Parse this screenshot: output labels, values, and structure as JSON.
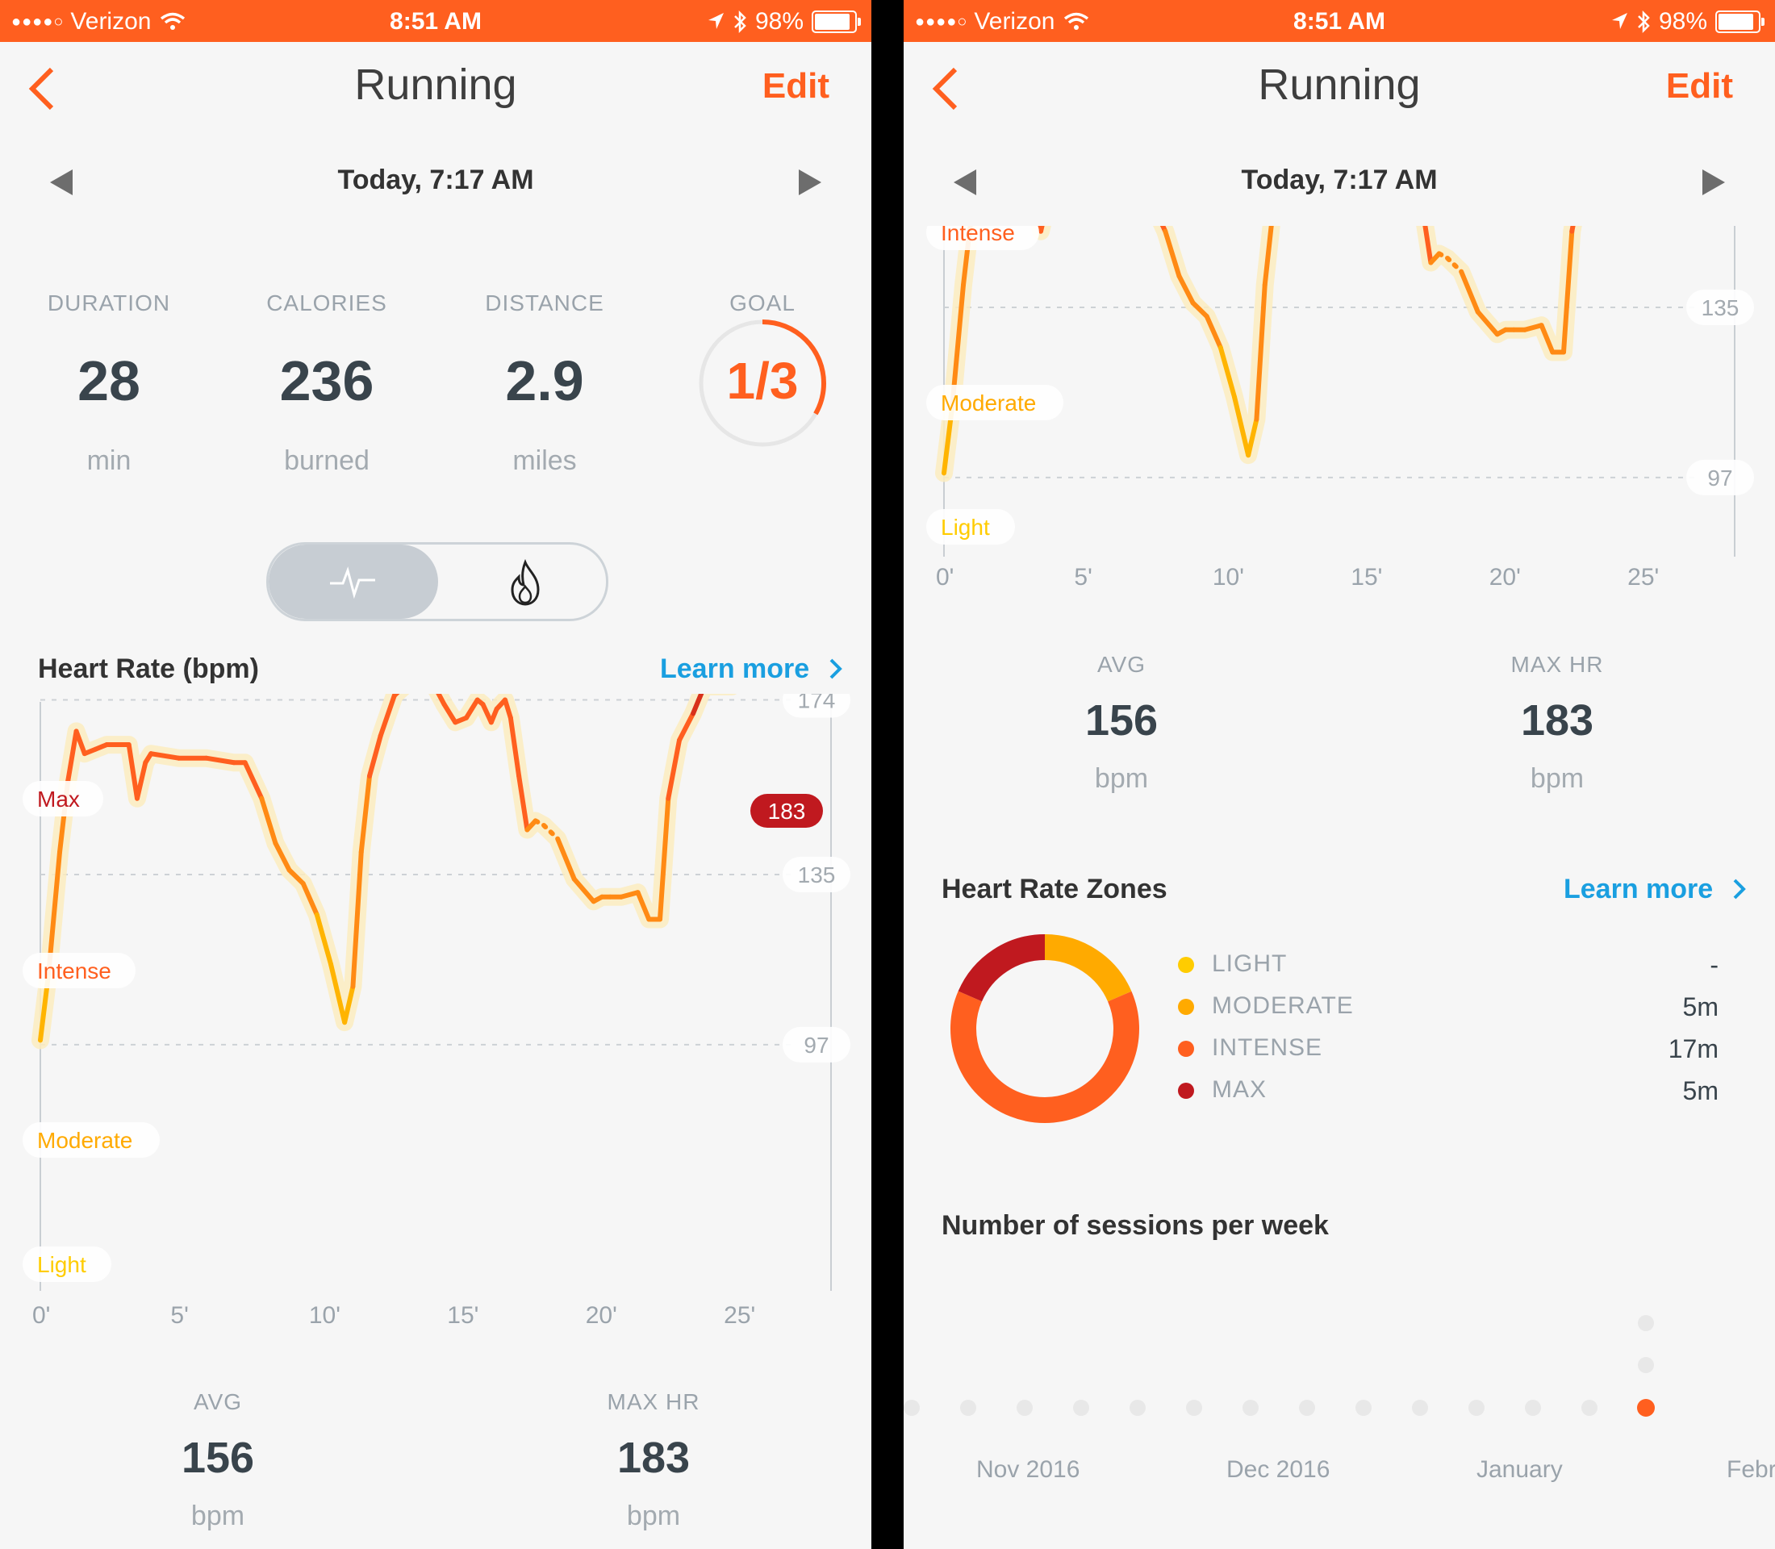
{
  "status_bar": {
    "carrier": "Verizon",
    "time": "8:51 AM",
    "battery": "98%",
    "battery_level": 0.98
  },
  "nav": {
    "title": "Running",
    "edit_label": "Edit"
  },
  "date_label": "Today, 7:17 AM",
  "stats": [
    {
      "label": "DURATION",
      "value": "28",
      "unit": "min"
    },
    {
      "label": "CALORIES",
      "value": "236",
      "unit": "burned"
    },
    {
      "label": "DISTANCE",
      "value": "2.9",
      "unit": "miles"
    }
  ],
  "goal": {
    "label": "GOAL",
    "value": "1/3",
    "progress": 0.333
  },
  "heart_rate": {
    "title": "Heart Rate (bpm)",
    "learn_more": "Learn more",
    "max_badge": "183",
    "zone_labels": [
      "Max",
      "Intense",
      "Moderate",
      "Light"
    ],
    "y_ticks": [
      "174",
      "135",
      "97"
    ],
    "x_ticks": [
      "0'",
      "5'",
      "10'",
      "15'",
      "20'",
      "25'"
    ],
    "avg_label": "AVG",
    "avg_value": "156",
    "avg_unit": "bpm",
    "max_label": "MAX HR",
    "max_value": "183",
    "max_unit": "bpm"
  },
  "chart_data": {
    "type": "line",
    "xlabel": "",
    "ylabel": "",
    "x_unit": "minutes",
    "xlim": [
      0,
      28
    ],
    "ylim": [
      76,
      195
    ],
    "x_ticks": [
      0,
      5,
      10,
      15,
      20,
      25
    ],
    "y_ticks": [
      97,
      135,
      174
    ],
    "zone_bands": [
      "Max",
      "Intense",
      "Moderate",
      "Light"
    ],
    "series": [
      {
        "x": [
          0,
          0.3,
          0.7,
          1,
          1.3,
          1.6,
          2,
          2.4,
          3.2,
          3.5,
          3.8,
          4,
          5,
          6,
          7,
          7.4,
          8,
          8.5,
          9,
          9.5,
          10,
          10.5,
          11,
          11.3,
          11.6,
          11.9,
          12.3,
          12.8,
          13.5,
          14,
          14.6,
          15,
          15.4,
          15.8,
          16,
          16.3,
          16.5,
          16.8,
          17,
          17.3,
          17.6,
          17.9,
          18.2,
          18.7,
          19.3,
          20,
          20.3,
          20.6,
          21,
          21.6,
          22,
          22.4,
          22.7,
          23.1,
          23.6,
          24,
          24.4,
          25,
          25.5,
          26,
          26.6,
          27.2
        ],
        "y": [
          98,
          113,
          140,
          156,
          167,
          162,
          163,
          164,
          164,
          152,
          160,
          162,
          161,
          161,
          160,
          160,
          152,
          142,
          136,
          133,
          126,
          115,
          102,
          110,
          140,
          157,
          166,
          175,
          179,
          180,
          173,
          169,
          170,
          174,
          173,
          169,
          172,
          174,
          170,
          157,
          145,
          147,
          146,
          143,
          134,
          129,
          130,
          130,
          130,
          131,
          125,
          125,
          152,
          165,
          171,
          177,
          177,
          177,
          179,
          181,
          182,
          180
        ],
        "projected": true
      }
    ]
  },
  "right": {
    "zone_labels": [
      "Intense",
      "Moderate",
      "Light"
    ],
    "y_ticks": [
      "135",
      "97"
    ],
    "x_ticks": [
      "0'",
      "5'",
      "10'",
      "15'",
      "20'",
      "25'"
    ],
    "avg_label": "AVG",
    "avg_value": "156",
    "avg_unit": "bpm",
    "max_label": "MAX HR",
    "max_value": "183",
    "max_unit": "bpm",
    "zones_title": "Heart Rate Zones",
    "zones_learn_more": "Learn more",
    "zones": [
      {
        "name": "LIGHT",
        "duration": "-",
        "minutes": 0,
        "color": "#ffcc00"
      },
      {
        "name": "MODERATE",
        "duration": "5m",
        "minutes": 5,
        "color": "#ffaa00"
      },
      {
        "name": "INTENSE",
        "duration": "17m",
        "minutes": 17,
        "color": "#ff5f1f"
      },
      {
        "name": "MAX",
        "duration": "5m",
        "minutes": 5,
        "color": "#c0191f"
      }
    ],
    "sessions_title": "Number of sessions per week",
    "sessions_months": [
      "Nov 2016",
      "Dec 2016",
      "January",
      "Febr"
    ]
  },
  "colors": {
    "accent": "#ff5f1f",
    "link": "#1a9fe0",
    "max": "#c0191f",
    "moderate": "#ffaa00",
    "light": "#ffcc00"
  },
  "icons": [
    "back-chevron-icon",
    "date-prev-icon",
    "date-next-icon",
    "heartbeat-icon",
    "flame-icon",
    "chevron-right-icon",
    "wifi-icon",
    "location-icon",
    "bluetooth-icon",
    "battery-icon"
  ]
}
